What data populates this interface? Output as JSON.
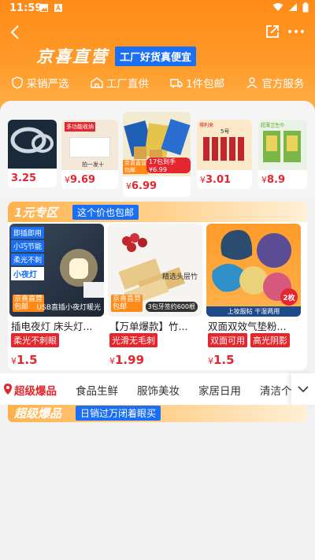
{
  "status": {
    "time": "11:59",
    "left_icons": [
      "image-icon",
      "text-icon"
    ],
    "right_icons": [
      "wifi-icon",
      "signal-icon",
      "battery-icon"
    ]
  },
  "nav": {
    "back_icon": "back-arrow-icon",
    "share_icon": "share-icon",
    "more_icon": "more-icon"
  },
  "brand": {
    "logo": "京喜直营",
    "tagline": "工厂好货真便宜"
  },
  "features": [
    {
      "icon": "shield-icon",
      "label": "采销严选"
    },
    {
      "icon": "factory-icon",
      "label": "工厂直供"
    },
    {
      "icon": "truck-icon",
      "label": "1件包邮"
    },
    {
      "icon": "person-icon",
      "label": "官方服务"
    }
  ],
  "carousel": [
    {
      "price_symbol": "",
      "price": "3.25"
    },
    {
      "price_symbol": "¥",
      "price": "9.69"
    },
    {
      "price_symbol": "¥",
      "price": "6.99"
    },
    {
      "price_symbol": "¥",
      "price": "3.01"
    },
    {
      "price_symbol": "¥",
      "price": "8.9"
    }
  ],
  "carousel_captions": {
    "c2_top": "多功能收纳",
    "c2_bottom": "拍一发十",
    "c3_badge": "17包到手",
    "c3_price": "6.99",
    "c3_tag": "京喜直营",
    "c3_tag2": "包邮",
    "c4_top": "得利来",
    "c4_label": "5号",
    "c5_top": "超薄卫生巾"
  },
  "section_one": {
    "title": "1元专区",
    "subtitle": "这个价也包邮",
    "products": [
      {
        "name": "插电夜灯 床头灯...",
        "tags": [
          "柔光不刺眼"
        ],
        "price_symbol": "¥",
        "price": "1.5",
        "badge_line1": "京喜直营",
        "badge_line2": "包邮",
        "caption": "USB直插小夜灯暖光",
        "side_text": [
          "即插即用",
          "小巧节能",
          "柔光不刺",
          "小夜灯"
        ]
      },
      {
        "name": "【万单爆款】竹...",
        "tags": [
          "光滑无毛刺"
        ],
        "price_symbol": "¥",
        "price": "1.99",
        "badge_line1": "京喜直营",
        "badge_line2": "包邮",
        "caption": "精选头层竹",
        "caption2": "3包牙签约600根"
      },
      {
        "name": "双面双效气垫粉...",
        "tags": [
          "双面可用",
          "高光阴影"
        ],
        "price_symbol": "¥",
        "price": "1.5",
        "badge_line1": "",
        "badge_line2": "",
        "caption": "上妆服帖 干湿两用",
        "count_badge": "2枚"
      }
    ]
  },
  "tabs": {
    "items": [
      "超级爆品",
      "食品生鲜",
      "服饰美妆",
      "家居日用",
      "清洁个"
    ],
    "active_index": 0,
    "expand_icon": "chevron-down-icon"
  },
  "section_two": {
    "title": "超级爆品",
    "subtitle": "日销过万闭着眼买"
  },
  "colors": {
    "brand_orange": "#ff8a17",
    "blue_tag": "#1b6ff5",
    "price_red": "#e4262f"
  }
}
